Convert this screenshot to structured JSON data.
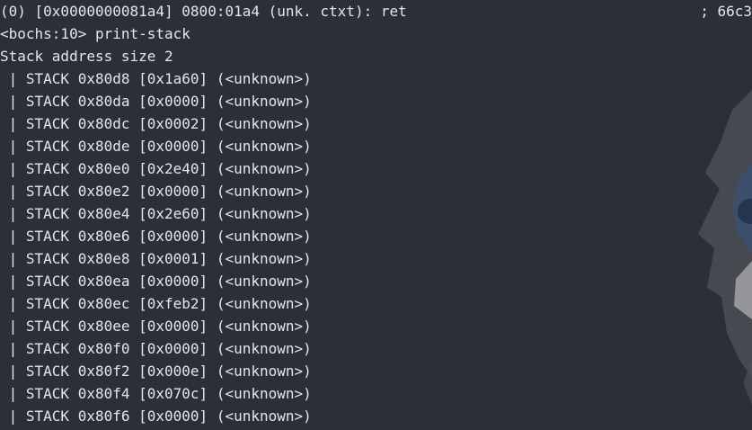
{
  "terminal": {
    "status_line": "(0) [0x0000000081a4] 0800:01a4 (unk. ctxt): ret",
    "status_comment": "; 66c3",
    "prompt": "<bochs:10> print-stack",
    "header": "Stack address size 2",
    "stack_lines": [
      " | STACK 0x80d8 [0x1a60] (<unknown>)",
      " | STACK 0x80da [0x0000] (<unknown>)",
      " | STACK 0x80dc [0x0002] (<unknown>)",
      " | STACK 0x80de [0x0000] (<unknown>)",
      " | STACK 0x80e0 [0x2e40] (<unknown>)",
      " | STACK 0x80e2 [0x0000] (<unknown>)",
      " | STACK 0x80e4 [0x2e60] (<unknown>)",
      " | STACK 0x80e6 [0x0000] (<unknown>)",
      " | STACK 0x80e8 [0x0001] (<unknown>)",
      " | STACK 0x80ea [0x0000] (<unknown>)",
      " | STACK 0x80ec [0xfeb2] (<unknown>)",
      " | STACK 0x80ee [0x0000] (<unknown>)",
      " | STACK 0x80f0 [0x0000] (<unknown>)",
      " | STACK 0x80f2 [0x000e] (<unknown>)",
      " | STACK 0x80f4 [0x070c] (<unknown>)",
      " | STACK 0x80f6 [0x0000] (<unknown>)"
    ]
  },
  "colors": {
    "background": "#2b2f37",
    "foreground": "#e4e6ea"
  }
}
